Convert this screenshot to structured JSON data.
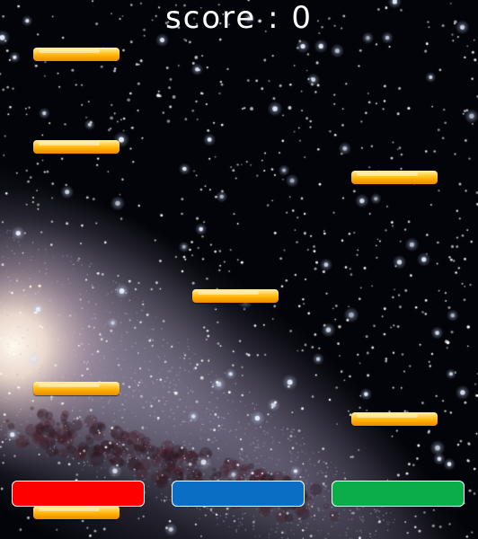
{
  "hud": {
    "score_text": "score : 0"
  },
  "colors": {
    "platform": "#ffb000",
    "button_red": "#ff0000",
    "button_blue": "#0a6fc4",
    "button_green": "#0aad47",
    "button_border": "#ffffff",
    "score_text": "#ffffff"
  },
  "platforms": [
    {
      "name": "platform-1"
    },
    {
      "name": "platform-2"
    },
    {
      "name": "platform-3"
    },
    {
      "name": "platform-4"
    },
    {
      "name": "platform-5"
    },
    {
      "name": "platform-6"
    },
    {
      "name": "platform-7"
    }
  ],
  "controls": [
    {
      "name": "red-button",
      "color": "#ff0000"
    },
    {
      "name": "blue-button",
      "color": "#0a6fc4"
    },
    {
      "name": "green-button",
      "color": "#0aad47"
    }
  ]
}
